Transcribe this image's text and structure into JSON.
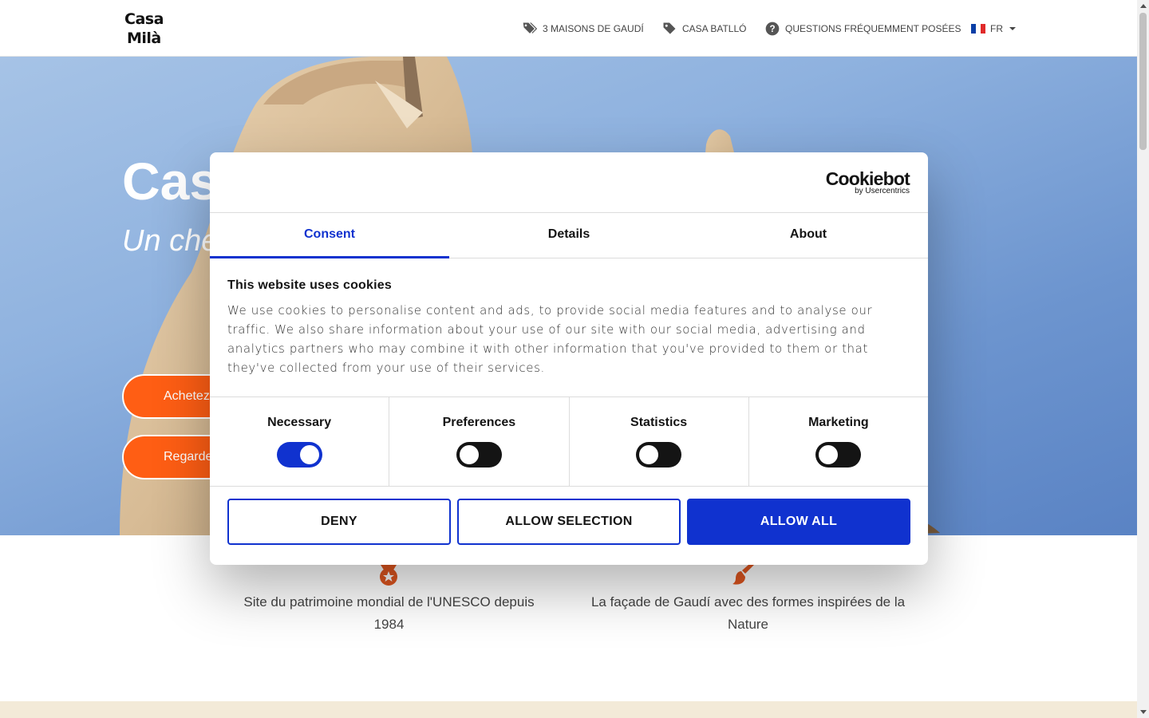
{
  "header": {
    "logo_line1": "Casa",
    "logo_line2": "Milà",
    "nav": [
      {
        "label": "3 MAISONS DE GAUDÍ",
        "icon": "tags-icon"
      },
      {
        "label": "CASA BATLLÓ",
        "icon": "tag-icon"
      },
      {
        "label": "QUESTIONS FRÉQUEMMENT POSÉES",
        "icon": "question-circle-icon"
      }
    ],
    "language": "FR"
  },
  "hero": {
    "title": "Cas",
    "subtitle": "Un che",
    "button1": "Achetez",
    "button2": "Regarde"
  },
  "features": [
    {
      "text": "Site du patrimoine mondial de l'UNESCO depuis 1984",
      "icon": "medal-icon"
    },
    {
      "text": "La façade de Gaudí avec des formes inspirées de la Nature",
      "icon": "paintbrush-icon"
    }
  ],
  "cookie_dialog": {
    "brand": "Cookiebot",
    "brand_sub": "by Usercentrics",
    "tabs": [
      "Consent",
      "Details",
      "About"
    ],
    "active_tab": "Consent",
    "heading": "This website uses cookies",
    "body": "We use cookies to personalise content and ads, to provide social media features and to analyse our traffic. We also share information about your use of our site with our social media, advertising and analytics partners who may combine it with other information that you've provided to them or that they've collected from your use of their services.",
    "toggles": [
      {
        "label": "Necessary",
        "on": true
      },
      {
        "label": "Preferences",
        "on": false
      },
      {
        "label": "Statistics",
        "on": false
      },
      {
        "label": "Marketing",
        "on": false
      }
    ],
    "buttons": {
      "deny": "DENY",
      "allow_selection": "ALLOW SELECTION",
      "allow_all": "ALLOW ALL"
    }
  },
  "colors": {
    "accent_blue": "#1032cf",
    "orange": "#ff5e14",
    "beige": "#f3ead8"
  }
}
